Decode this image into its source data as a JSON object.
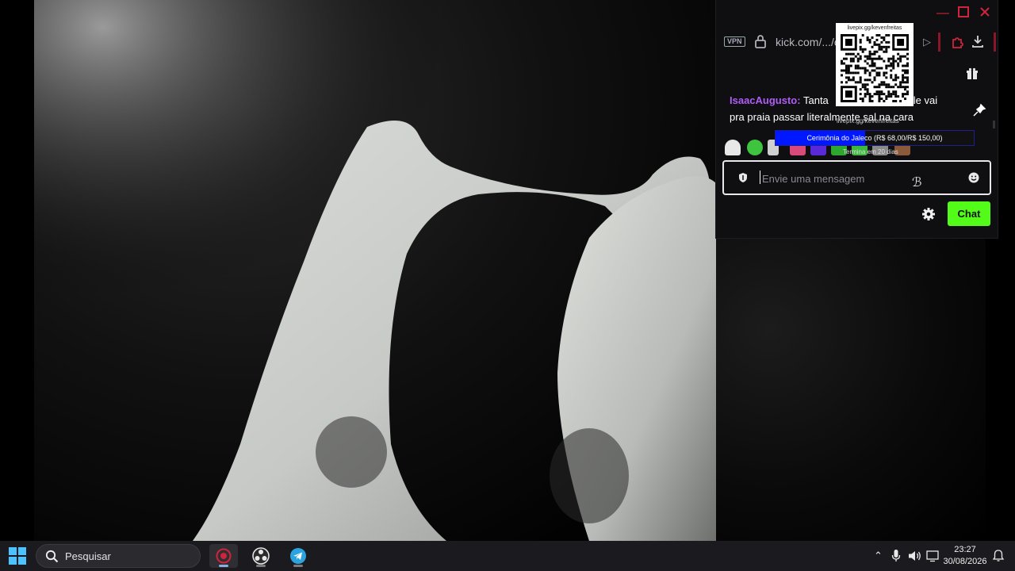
{
  "browser": {
    "vpn_label": "VPN",
    "url": "kick.com/.../c",
    "qr_caption": "livepix.gg/kevenfreitas"
  },
  "chat": {
    "message_user": "IsaacAugusto",
    "message_colon": ":",
    "message_text_line1": "Tanta",
    "message_text_line1_end": "olhar ele vai",
    "message_text_line2": "pra praia passar literalmente sal na cara",
    "input_placeholder": "Envie uma mensagem",
    "send_label": "Chat",
    "user_color": "#b05cf7",
    "accent_color": "#53fc18"
  },
  "goal": {
    "caption": "livepix.gg/kevenfreitas",
    "text": "Cerimônia do Jaleco (R$ 68,00/R$ 150,00)",
    "current": 68,
    "target": 150,
    "subtext": "Termina em 20 dias",
    "bar_color": "#0018ff"
  },
  "emotes": [
    "ghost-emote",
    "green-smile-emote",
    "hands-emote",
    "pink-emote",
    "purple-emote",
    "green-emote",
    "green-emote-2",
    "grey-emote",
    "brown-emote"
  ],
  "taskbar": {
    "search_placeholder": "Pesquisar",
    "time": "23:27",
    "date": "30/08/2026",
    "apps": [
      "recording-app",
      "obs-studio",
      "telegram"
    ]
  }
}
